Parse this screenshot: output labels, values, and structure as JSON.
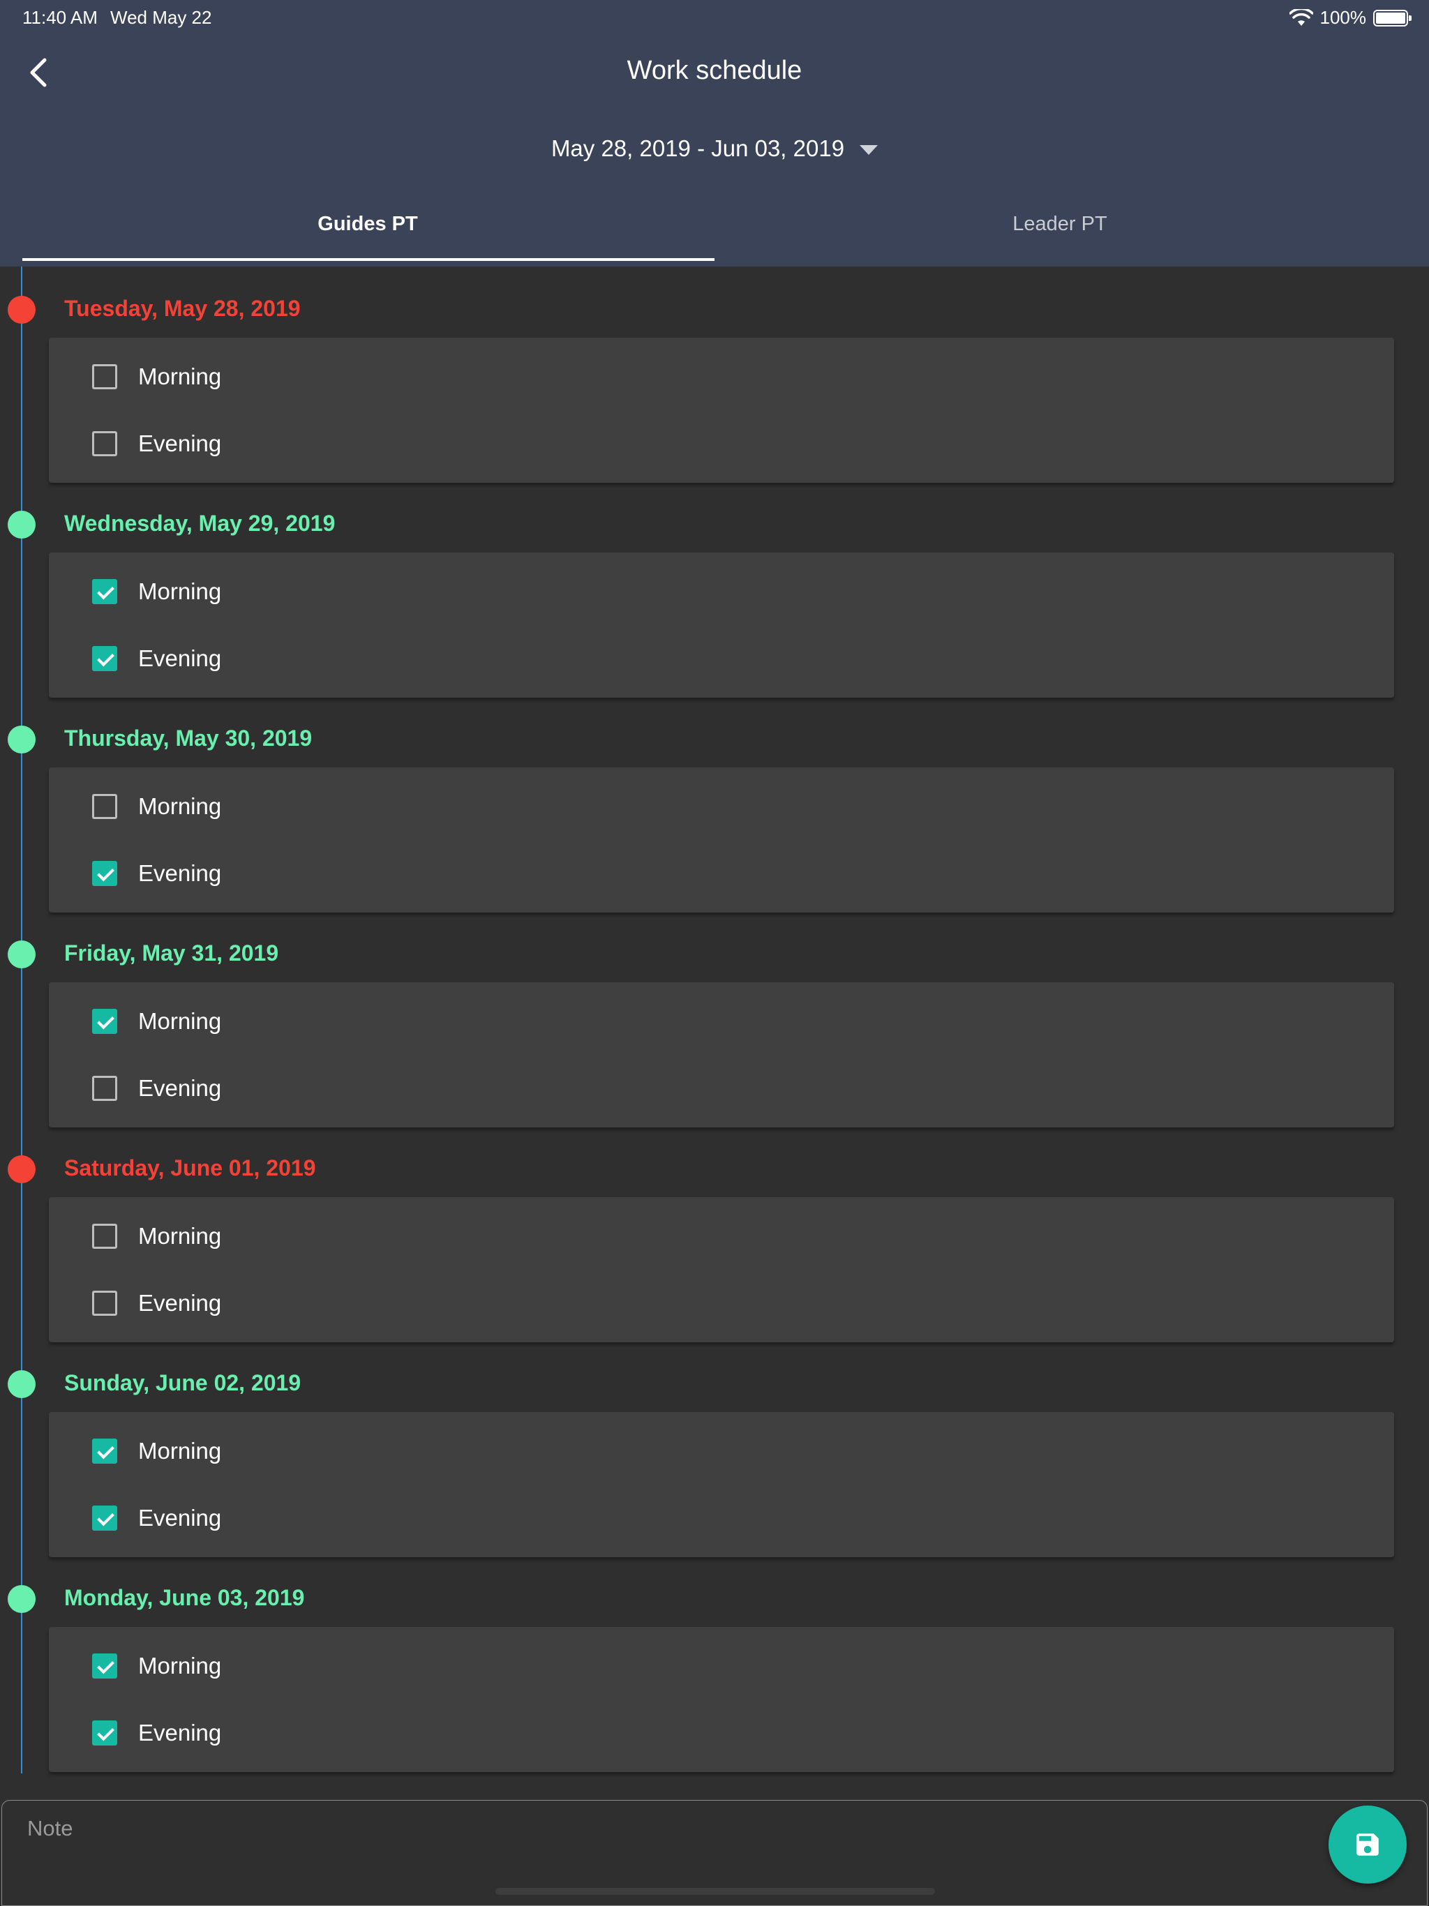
{
  "status_bar": {
    "time": "11:40 AM",
    "date": "Wed May 22",
    "battery": "100%"
  },
  "header": {
    "title": "Work schedule",
    "date_range": "May 28, 2019 - Jun 03, 2019"
  },
  "tabs": [
    {
      "label": "Guides PT",
      "active": true
    },
    {
      "label": "Leader PT",
      "active": false
    }
  ],
  "colors": {
    "unavailable": "#f44336",
    "available": "#69f0ae",
    "accent": "#16b9a2",
    "header_bg": "#3a4357"
  },
  "days": [
    {
      "title": "Tuesday, May 28, 2019",
      "status": "unavailable",
      "shifts": [
        {
          "label": "Morning",
          "checked": false
        },
        {
          "label": "Evening",
          "checked": false
        }
      ]
    },
    {
      "title": "Wednesday, May 29, 2019",
      "status": "available",
      "shifts": [
        {
          "label": "Morning",
          "checked": true
        },
        {
          "label": "Evening",
          "checked": true
        }
      ]
    },
    {
      "title": "Thursday, May 30, 2019",
      "status": "available",
      "shifts": [
        {
          "label": "Morning",
          "checked": false
        },
        {
          "label": "Evening",
          "checked": true
        }
      ]
    },
    {
      "title": "Friday, May 31, 2019",
      "status": "available",
      "shifts": [
        {
          "label": "Morning",
          "checked": true
        },
        {
          "label": "Evening",
          "checked": false
        }
      ]
    },
    {
      "title": "Saturday, June 01, 2019",
      "status": "unavailable",
      "shifts": [
        {
          "label": "Morning",
          "checked": false
        },
        {
          "label": "Evening",
          "checked": false
        }
      ]
    },
    {
      "title": "Sunday, June 02, 2019",
      "status": "available",
      "shifts": [
        {
          "label": "Morning",
          "checked": true
        },
        {
          "label": "Evening",
          "checked": true
        }
      ]
    },
    {
      "title": "Monday, June 03, 2019",
      "status": "available",
      "shifts": [
        {
          "label": "Morning",
          "checked": true
        },
        {
          "label": "Evening",
          "checked": true
        }
      ]
    }
  ],
  "note": {
    "placeholder": "Note",
    "value": ""
  },
  "icons": {
    "back": "chevron-left-icon",
    "dropdown": "caret-down-icon",
    "save": "floppy-disk-icon"
  }
}
